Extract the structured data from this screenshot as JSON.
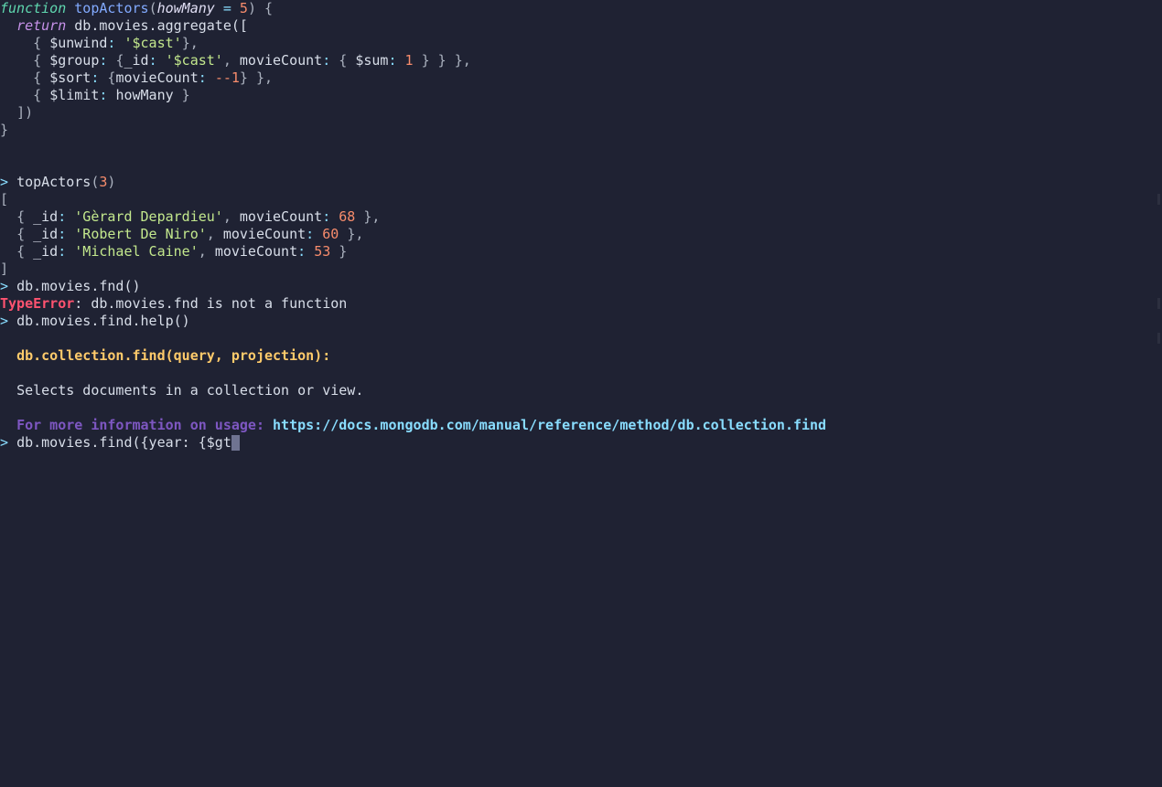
{
  "code": {
    "fn_keyword": "function",
    "fn_name": "topActors",
    "param_name": "howMany",
    "param_default": "5",
    "return_kw": "return",
    "stmt": "db.movies.aggregate([",
    "unwind_op": "$unwind",
    "unwind_val": "'$cast'",
    "group_op": "$group",
    "group_idkey": "_id",
    "group_idval": "'$cast'",
    "group_mcount": "movieCount",
    "sum_op": "$sum",
    "sum_val": "1",
    "sort_op": "$sort",
    "sort_key": "movieCount",
    "sort_dir": "-1",
    "limit_op": "$limit",
    "limit_val": "howMany"
  },
  "call": {
    "prompt": ">",
    "fn": "topActors",
    "arg": "3"
  },
  "results": [
    {
      "id": "'Gèrard Depardieu'",
      "count": "68"
    },
    {
      "id": "'Robert De Niro'",
      "count": "60"
    },
    {
      "id": "'Michael Caine'",
      "count": "53"
    }
  ],
  "error": {
    "cmd": "db.movies.fnd()",
    "type": "TypeError",
    "msg": ": db.movies.fnd is not a function"
  },
  "help": {
    "cmd": "db.movies.find.help()",
    "sig": "db.collection.find(query, projection):",
    "desc": "Selects documents in a collection or view.",
    "more": "For more information on usage: ",
    "url": "https://docs.mongodb.com/manual/reference/method/db.collection.find"
  },
  "input": {
    "text": "db.movies.find({year: {$gt"
  }
}
